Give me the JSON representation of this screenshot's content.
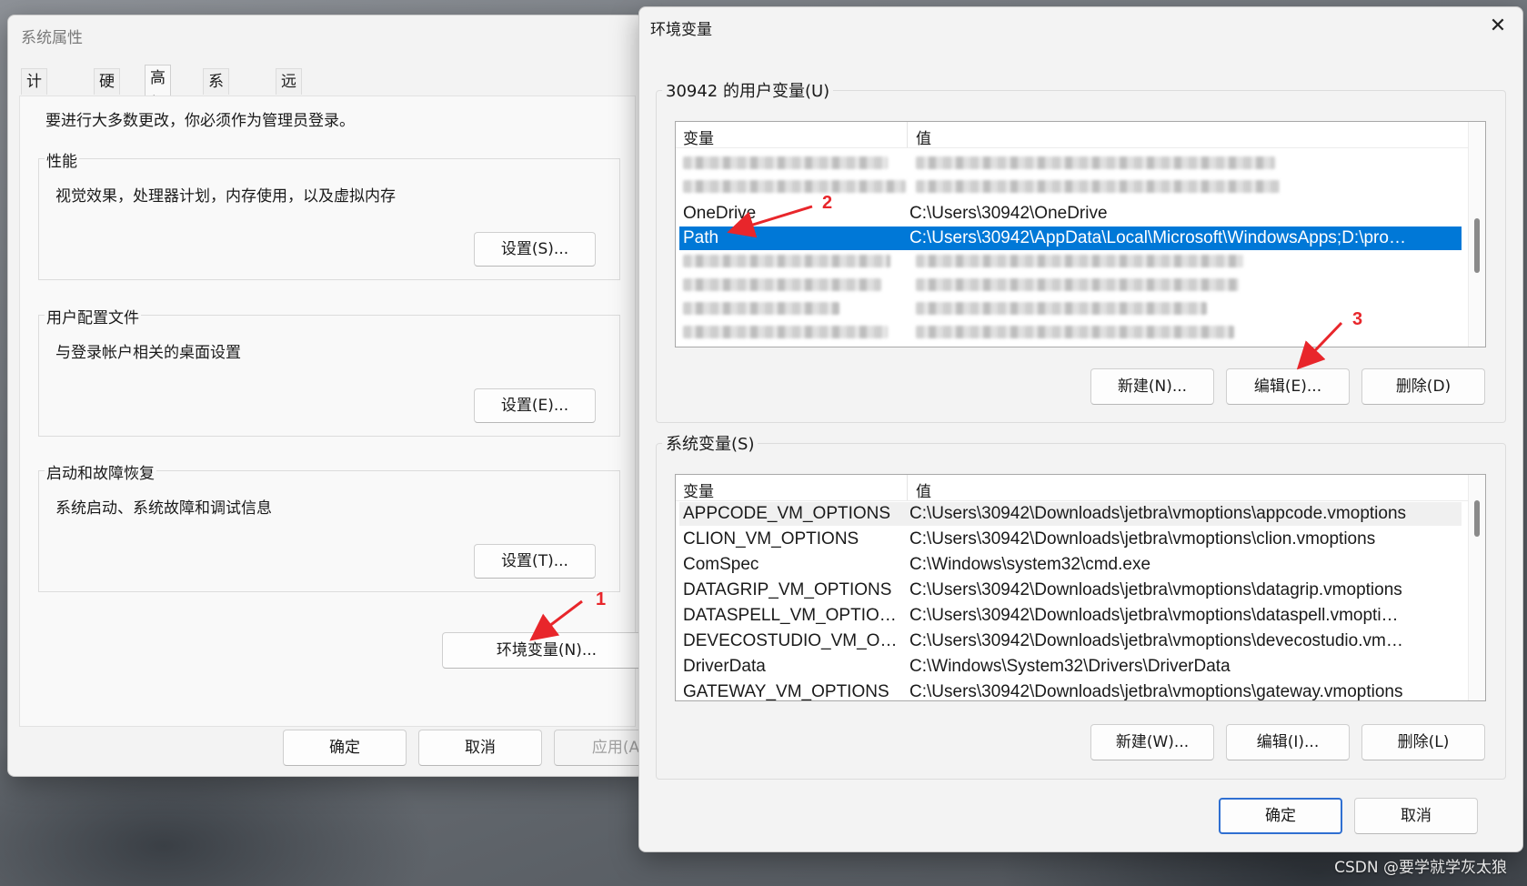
{
  "sys_props": {
    "title": "系统属性",
    "tabs": [
      {
        "label": "计算机名"
      },
      {
        "label": "硬件"
      },
      {
        "label": "高级"
      },
      {
        "label": "系统保护"
      },
      {
        "label": "远程"
      }
    ],
    "admin_note": "要进行大多数更改，你必须作为管理员登录。",
    "performance": {
      "label": "性能",
      "desc": "视觉效果，处理器计划，内存使用，以及虚拟内存",
      "button": "设置(S)..."
    },
    "user_profiles": {
      "label": "用户配置文件",
      "desc": "与登录帐户相关的桌面设置",
      "button": "设置(E)..."
    },
    "startup": {
      "label": "启动和故障恢复",
      "desc": "系统启动、系统故障和调试信息",
      "button": "设置(T)..."
    },
    "env_button": "环境变量(N)...",
    "ok": "确定",
    "cancel": "取消",
    "apply": "应用(A"
  },
  "env_vars": {
    "title": "环境变量",
    "close_glyph": "✕",
    "user_group_label": "30942 的用户变量(U)",
    "col_name": "变量",
    "col_value": "值",
    "user_rows": [
      {
        "name": "OneDrive",
        "value": "C:\\Users\\30942\\OneDrive"
      },
      {
        "name": "Path",
        "value": "C:\\Users\\30942\\AppData\\Local\\Microsoft\\WindowsApps;D:\\progr..."
      }
    ],
    "user_buttons": {
      "new": "新建(N)...",
      "edit": "编辑(E)...",
      "delete": "删除(D)"
    },
    "sys_group_label": "系统变量(S)",
    "sys_rows": [
      {
        "name": "APPCODE_VM_OPTIONS",
        "value": "C:\\Users\\30942\\Downloads\\jetbra\\vmoptions\\appcode.vmoptions"
      },
      {
        "name": "CLION_VM_OPTIONS",
        "value": "C:\\Users\\30942\\Downloads\\jetbra\\vmoptions\\clion.vmoptions"
      },
      {
        "name": "ComSpec",
        "value": "C:\\Windows\\system32\\cmd.exe"
      },
      {
        "name": "DATAGRIP_VM_OPTIONS",
        "value": "C:\\Users\\30942\\Downloads\\jetbra\\vmoptions\\datagrip.vmoptions"
      },
      {
        "name": "DATASPELL_VM_OPTIONS",
        "value": "C:\\Users\\30942\\Downloads\\jetbra\\vmoptions\\dataspell.vmoptions"
      },
      {
        "name": "DEVECOSTUDIO_VM_OPTIO...",
        "value": "C:\\Users\\30942\\Downloads\\jetbra\\vmoptions\\devecostudio.vmop..."
      },
      {
        "name": "DriverData",
        "value": "C:\\Windows\\System32\\Drivers\\DriverData"
      },
      {
        "name": "GATEWAY_VM_OPTIONS",
        "value": "C:\\Users\\30942\\Downloads\\jetbra\\vmoptions\\gateway.vmoptions"
      }
    ],
    "sys_buttons": {
      "new": "新建(W)...",
      "edit": "编辑(I)...",
      "delete": "删除(L)"
    },
    "ok": "确定",
    "cancel": "取消"
  },
  "annotations": {
    "m1": "1",
    "m2": "2",
    "m3": "3",
    "color": "#e8262b"
  },
  "watermark": "CSDN @要学就学灰太狼",
  "colors": {
    "selection": "#0078d7",
    "primary_border": "#2f6fd1"
  }
}
